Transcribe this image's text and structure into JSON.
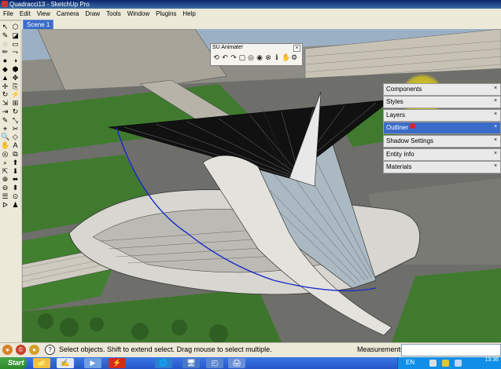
{
  "window": {
    "title": "Quadracci13 - SketchUp Pro"
  },
  "menu": [
    "File",
    "Edit",
    "View",
    "Camera",
    "Draw",
    "Tools",
    "Window",
    "Plugins",
    "Help"
  ],
  "scene_tab": "Scene 1",
  "left_tools_a": [
    "↖",
    "✎",
    "◌",
    "✏",
    "●",
    "◆",
    "▲",
    "✢",
    "↻",
    "⇲",
    "⇥",
    "✎",
    "⌖",
    "🔍",
    "✋",
    "◎",
    "⌕",
    "⇱",
    "⊕",
    "⊖",
    "☰",
    "ᐅ"
  ],
  "left_tools_b": [
    "⬡",
    "◪",
    "▭",
    "⤳",
    "◑",
    "⬢",
    "✥",
    "⎘",
    "⚡",
    "⊞",
    "↻",
    "⤡",
    "✂",
    "◇",
    "A",
    "⧉",
    "⬆",
    "⬇",
    "⬌",
    "⬍",
    "⊙",
    "♟"
  ],
  "animate_toolbar": {
    "title": "SU Animate!",
    "buttons": [
      "⟲",
      "↶",
      "↷",
      "▢",
      "◎",
      "◉",
      "⊗",
      "ℹ",
      "✋",
      "⚙"
    ]
  },
  "trays": [
    {
      "label": "Components",
      "active": false
    },
    {
      "label": "Styles",
      "active": false
    },
    {
      "label": "Layers",
      "active": false
    },
    {
      "label": "Outliner",
      "active": true
    },
    {
      "label": "Shadow Settings",
      "active": false
    },
    {
      "label": "Entity Info",
      "active": false
    },
    {
      "label": "Materials",
      "active": false
    }
  ],
  "status": {
    "text": "Select objects. Shift to extend select. Drag mouse to select multiple.",
    "measurements_label": "Measurements",
    "measurements_value": ""
  },
  "taskbar": {
    "start": "Start",
    "apps": [
      "📁",
      "✍",
      "▶",
      "⚡",
      "🌐",
      "🖥",
      "◰",
      "🖨"
    ],
    "lang": "EN",
    "time": "13:36"
  },
  "colors": {
    "sky": "#9bb0c4",
    "grass": "#3f7a2e",
    "tray_active": "#3b6cc9",
    "highlight": "#ffe600",
    "path_line": "#1a2acb"
  }
}
